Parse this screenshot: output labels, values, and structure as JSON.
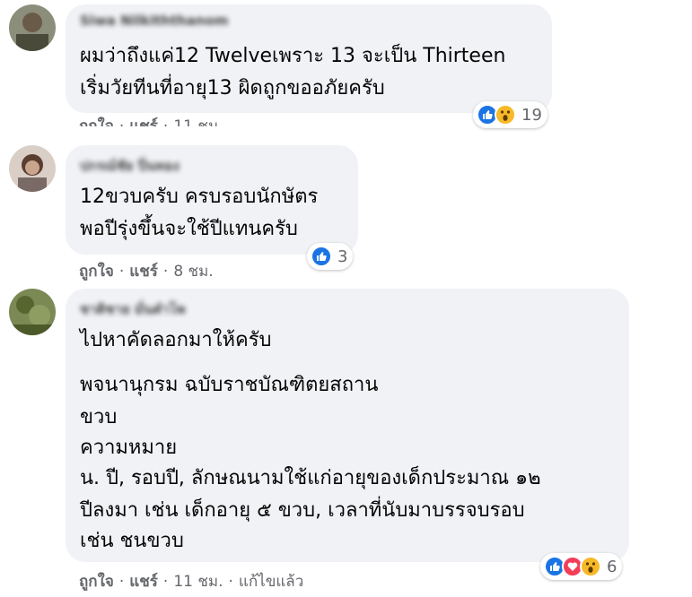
{
  "comments": [
    {
      "author": "Siwa Nilkiththanom",
      "lines": [
        "ผมว่าถึงแค่12 Twelveเพราะ 13 จะเป็น Thirteen",
        "เริ่มวัยทีนที่อายุ13 ผิดถูกขออภัยครับ"
      ],
      "reactions": {
        "icons": [
          "like-icon",
          "wow-icon"
        ],
        "count": "19"
      },
      "actions": {
        "like": "ถูกใจ",
        "reply": "แชร์",
        "time": "11 ชม."
      }
    },
    {
      "author": "ปกรณ์ชัย ปิ่นทอง",
      "lines": [
        "12ขวบครับ ครบรอบนักษัตร",
        "พอปีรุ่งขึ้นจะใช้ปีแทนครับ"
      ],
      "reactions": {
        "icons": [
          "like-icon"
        ],
        "count": "3"
      },
      "actions": {
        "like": "ถูกใจ",
        "reply": "แชร์",
        "time": "8 ชม."
      }
    },
    {
      "author": "ชาติชาย มั่นคำโพ",
      "lines": [
        "ไปหาคัดลอกมาให้ครับ",
        "พจนานุกรม ฉบับราชบัณฑิตยสถาน",
        "ขวบ",
        "ความหมาย",
        "น. ปี, รอบปี, ลักษณนามใช้แก่อายุของเด็กประมาณ ๑๒",
        "ปีลงมา เช่น เด็กอายุ ๕ ขวบ, เวลาที่นับมาบรรจบรอบ",
        "เช่น ชนขวบ"
      ],
      "reactions": {
        "icons": [
          "like-icon",
          "love-icon",
          "wow-icon"
        ],
        "count": "6"
      },
      "actions": {
        "like": "ถูกใจ",
        "reply": "แชร์",
        "time": "11 ชม.",
        "edited": "แก้ไขแล้ว"
      }
    }
  ]
}
